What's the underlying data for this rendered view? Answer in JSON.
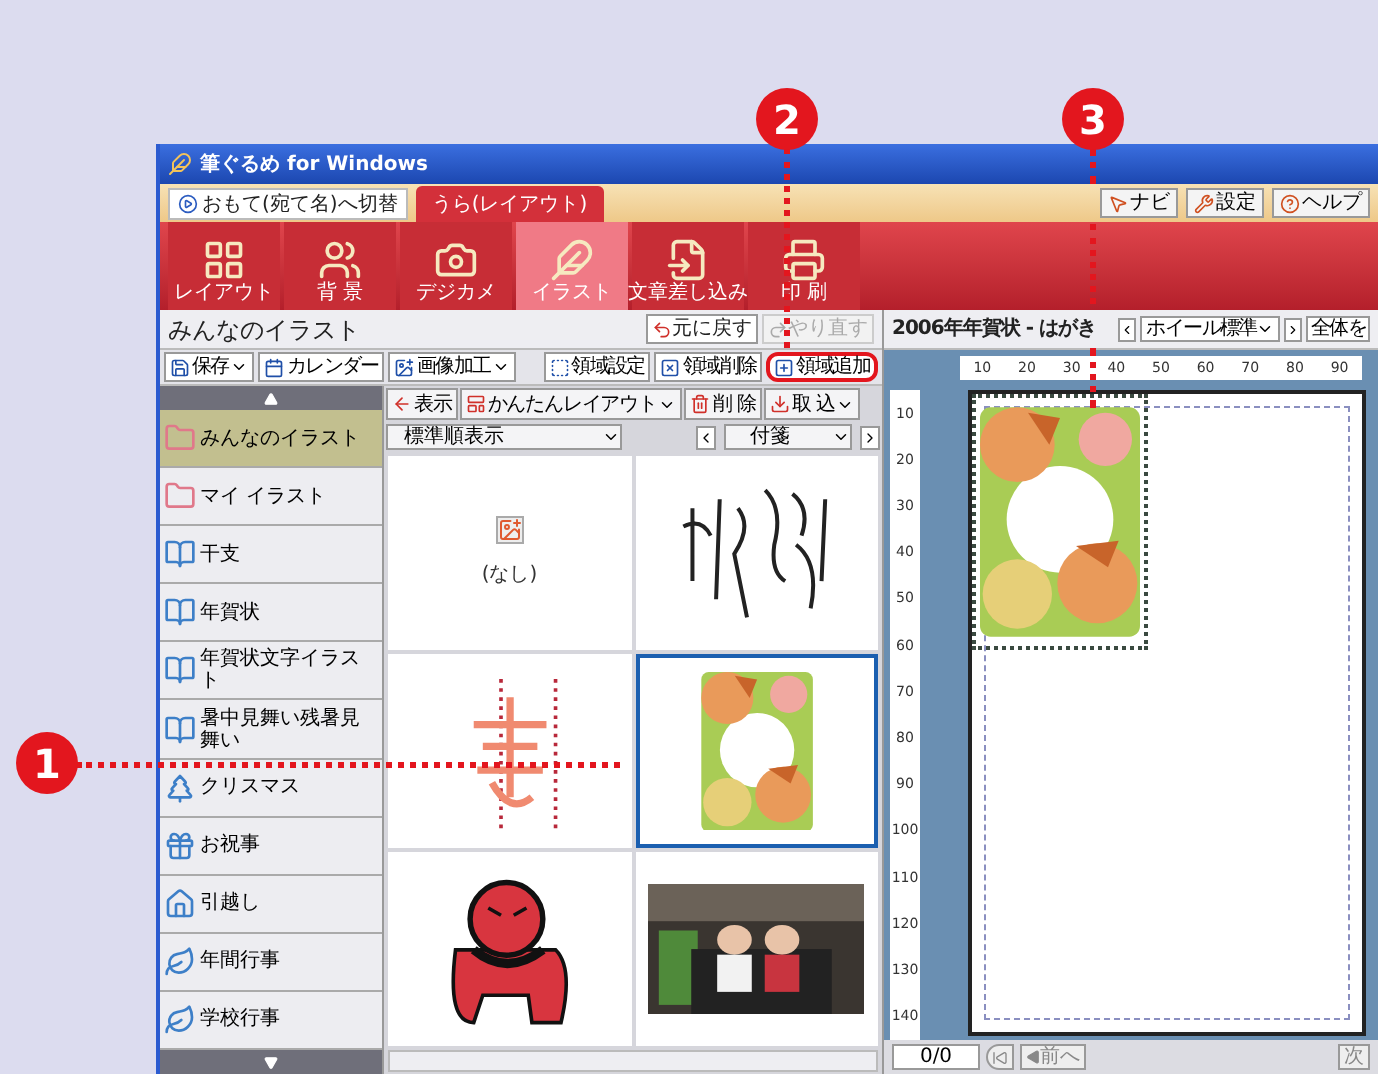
{
  "callouts": [
    {
      "label": "1"
    },
    {
      "label": "2"
    },
    {
      "label": "3"
    }
  ],
  "window": {
    "title": "筆ぐるめ for Windows"
  },
  "mode_tabs": [
    {
      "label": "おもて(宛て名)へ切替",
      "selected": false
    },
    {
      "label": "うら(レイアウト)",
      "selected": true
    }
  ],
  "help_buttons": [
    "ナビ",
    "設定",
    "ヘルプ"
  ],
  "main_toolbar": [
    {
      "label": "レイアウト",
      "selected": false
    },
    {
      "label": "背 景",
      "selected": false
    },
    {
      "label": "デジカメ",
      "selected": false
    },
    {
      "label": "イラスト",
      "selected": true
    },
    {
      "label": "文章差し込み",
      "selected": false
    },
    {
      "label": "印 刷",
      "selected": false
    }
  ],
  "left_panel": {
    "title": "みんなのイラスト",
    "undo": {
      "label": "元に戻す",
      "disabled": false
    },
    "redo": {
      "label": "やり直す",
      "disabled": true
    },
    "tools": [
      {
        "label": "保存",
        "dropdown": true,
        "highlighted": false
      },
      {
        "label": "カレンダー",
        "dropdown": false,
        "highlighted": false
      },
      {
        "label": "画像加工",
        "dropdown": true,
        "highlighted": false
      },
      {
        "label": "領域設定",
        "dropdown": false,
        "highlighted": false
      },
      {
        "label": "領域削除",
        "dropdown": false,
        "highlighted": false
      },
      {
        "label": "領域追加",
        "dropdown": false,
        "highlighted": true
      }
    ],
    "categories": [
      {
        "label": "みんなのイラスト",
        "selected": true
      },
      {
        "label": "マイ イラスト",
        "selected": false
      },
      {
        "label": "干支",
        "selected": false
      },
      {
        "label": "年賀状",
        "selected": false
      },
      {
        "label": "年賀状文字イラスト",
        "selected": false
      },
      {
        "label": "暑中見舞い残暑見舞い",
        "selected": false
      },
      {
        "label": "クリスマス",
        "selected": false
      },
      {
        "label": "お祝事",
        "selected": false
      },
      {
        "label": "引越し",
        "selected": false
      },
      {
        "label": "年間行事",
        "selected": false
      },
      {
        "label": "学校行事",
        "selected": false
      }
    ],
    "view_buttons": [
      {
        "label": "表示",
        "dropdown": false
      },
      {
        "label": "かんたんレイアウト",
        "dropdown": true
      },
      {
        "label": "削 除",
        "dropdown": false
      },
      {
        "label": "取 込",
        "dropdown": true
      }
    ],
    "sort": "標準順表示",
    "tag": "付箋",
    "thumbnails": [
      {
        "kind": "empty",
        "label": "(なし)",
        "selected": false
      },
      {
        "kind": "picture",
        "selected": false
      },
      {
        "kind": "picture",
        "selected": false
      },
      {
        "kind": "picture",
        "selected": true
      },
      {
        "kind": "picture",
        "selected": false
      },
      {
        "kind": "picture",
        "selected": false
      }
    ]
  },
  "document": {
    "title": "2006年年賀状 - はがき",
    "zoom_mode": "ホイール標準",
    "zoom": "全体を",
    "h_ruler": [
      "10",
      "20",
      "30",
      "40",
      "50",
      "60",
      "70",
      "80",
      "90"
    ],
    "v_ruler": [
      "10",
      "20",
      "30",
      "40",
      "50",
      "60",
      "70",
      "80",
      "90",
      "100",
      "110",
      "120",
      "130",
      "140"
    ],
    "page_field": "0/0",
    "prev": "前へ",
    "next": "次"
  }
}
